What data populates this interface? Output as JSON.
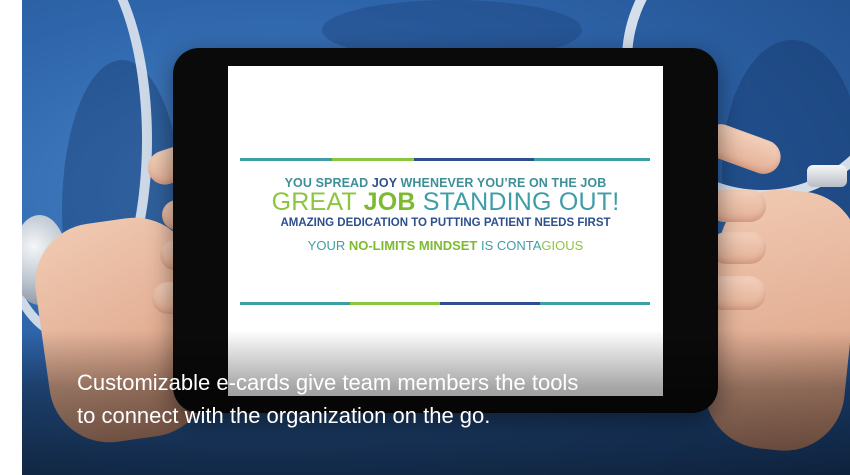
{
  "card": {
    "line1_a": "YOU SPREAD ",
    "line1_b": "JOY",
    "line1_c": " WHENEVER YOU’RE ON THE JOB",
    "line2_a": "GREAT ",
    "line2_b": "JOB",
    "line2_c": " STANDING OUT!",
    "line3": "AMAZING DEDICATION TO PUTTING PATIENT NEEDS FIRST",
    "line4_a": "YOUR ",
    "line4_b": "NO-LIMITS MINDSET",
    "line4_c": " IS CONTA",
    "line4_d": "GIOUS"
  },
  "caption": {
    "line1": "Customizable e-cards give team members the tools",
    "line2": "to connect with the organization on the go."
  },
  "colors": {
    "teal": "#3e9ea8",
    "green": "#8cc63f",
    "navy": "#2d4f8c",
    "scrubs": "#2f66ac"
  }
}
